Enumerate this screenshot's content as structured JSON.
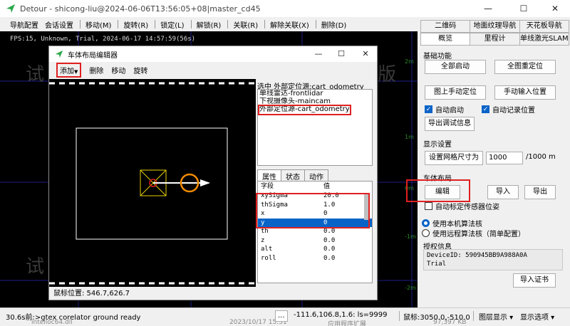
{
  "window": {
    "title": "Detour - shicong-liu@2024-06-06T13:56:05+08|master_cd45",
    "controls": {
      "minimize": "—",
      "maximize": "☐",
      "close": "✕"
    }
  },
  "menu": {
    "items": [
      "导航配置",
      "会话设置",
      "移动(M)",
      "旋转(R)",
      "锁定(L)",
      "解锁(R)",
      "关联(R)",
      "解除关联(X)",
      "删除(D)"
    ]
  },
  "viewport": {
    "fps_text": "FPS:15, Unknown, Trial, 2024-06-17 14:57:59(56s)",
    "watermarks": [
      "试",
      "试",
      "版"
    ],
    "grid_labels": [
      "2m",
      "1m",
      "0m",
      "0m",
      "-1m",
      "-2m"
    ]
  },
  "dialog": {
    "title": "车体布局编辑器",
    "controls": {
      "minimize": "—",
      "maximize": "☐",
      "close": "✕"
    },
    "toolbar": {
      "add": "添加",
      "delete": "删除",
      "move": "移动",
      "rotate": "旋转"
    },
    "selected_label": "选中 外部定位源:cart_odometry",
    "layers": [
      "单线雷达-frontlidar",
      "下视摄像头-maincam",
      "外部定位源-cart_odometry"
    ],
    "prop_tabs": [
      "属性",
      "状态",
      "动作"
    ],
    "prop_headers": {
      "key": "字段",
      "value": "值"
    },
    "properties": [
      {
        "key": "xySigma",
        "value": "20.0"
      },
      {
        "key": "thSigma",
        "value": "1.0"
      },
      {
        "key": "x",
        "value": "0"
      },
      {
        "key": "y",
        "value": "0"
      },
      {
        "key": "th",
        "value": "0.0"
      },
      {
        "key": "z",
        "value": "0.0"
      },
      {
        "key": "alt",
        "value": "0.0"
      },
      {
        "key": "roll",
        "value": "0.0"
      }
    ],
    "status": "鼠标位置: 546.7,626.7"
  },
  "right_panel": {
    "tabs_row1": [
      "二维码",
      "地面纹理导航",
      "天花板导航"
    ],
    "tabs_row2": [
      "概览",
      "里程计",
      "单线激光SLAM"
    ],
    "basic": {
      "title": "基础功能",
      "start_all": "全部启动",
      "reset_all": "全图重定位",
      "manual_locate": "图上手动定位",
      "manual_input": "手动输入位置",
      "auto_start": "自动启动",
      "auto_record": "自动记录位置",
      "export_debug": "导出调试信息"
    },
    "display": {
      "title": "显示设置",
      "grid_btn": "设置网格尺寸为",
      "grid_value": "1000",
      "grid_unit": "/1000 m"
    },
    "layout": {
      "title": "车体布局",
      "edit": "编辑",
      "import": "导入",
      "export": "导出",
      "auto_calib": "自动标定传感器位姿"
    },
    "algo": {
      "local": "使用本机算法核",
      "remote": "使用远程算法核（简单配置）"
    },
    "license": {
      "title": "授权信息",
      "device": "DeviceID: 590945BB9A988A0A",
      "type": "Trial",
      "import": "导入证书"
    }
  },
  "statusbar": {
    "log": "30.6s前:>gtex corelator ground ready",
    "more": "...",
    "coords": "-111.6,106.8,1.6: ls=9999",
    "mouse": "鼠标:3050.0,-510.0",
    "layer_display": "图层显示 ▾",
    "display_options": "显示选项 ▾",
    "under1": "intelloc64.dll",
    "under2": "2023/10/17 15:51",
    "under3": "应用程序扩展",
    "under4": "97,397 KB"
  }
}
